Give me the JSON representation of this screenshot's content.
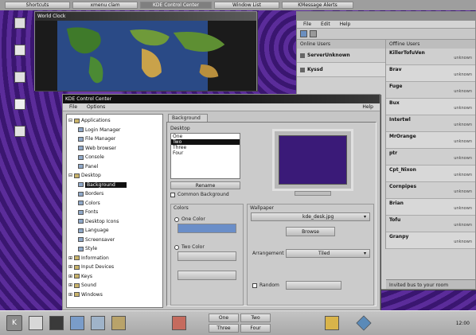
{
  "top_tabs": [
    "Shortcuts",
    "xmenu clam",
    "KDE Control Center",
    "Window List",
    "KMessage Alerts"
  ],
  "world_clock": {
    "title": "World Clock"
  },
  "users_window": {
    "menu": [
      "File",
      "Edit",
      "Help"
    ],
    "online_header": "Online Users",
    "offline_header": "Offline Users",
    "online_users": [
      "ServerUnknown",
      "Kyssd"
    ],
    "offline_users": [
      "KillerTofuVen",
      "Brav",
      "Fuge",
      "Bux",
      "Intertwl",
      "MrOrange",
      "ptr",
      "Cpt_Nixon",
      "Cornpipes",
      "Brian",
      "Tofu",
      "Granpy"
    ],
    "status_values": [
      "unknown",
      "unknown",
      "unknown",
      "unknown",
      "unknown",
      "unknown",
      "unknown",
      "unknown",
      "unknown",
      "unknown",
      "unknown",
      "unknown"
    ],
    "status_text": "Invited bus to your room"
  },
  "control_center": {
    "title": "KDE Control Center",
    "menu": [
      "File",
      "Options"
    ],
    "help_label": "Help",
    "tree": [
      {
        "label": "Applications",
        "level": 0,
        "expanded": true
      },
      {
        "label": "Login Manager",
        "level": 1
      },
      {
        "label": "File Manager",
        "level": 1
      },
      {
        "label": "Web browser",
        "level": 1
      },
      {
        "label": "Console",
        "level": 1
      },
      {
        "label": "Panel",
        "level": 1
      },
      {
        "label": "Desktop",
        "level": 0,
        "expanded": true
      },
      {
        "label": "Background",
        "level": 1,
        "selected": true
      },
      {
        "label": "Borders",
        "level": 1
      },
      {
        "label": "Colors",
        "level": 1
      },
      {
        "label": "Fonts",
        "level": 1
      },
      {
        "label": "Desktop Icons",
        "level": 1
      },
      {
        "label": "Language",
        "level": 1
      },
      {
        "label": "Screensaver",
        "level": 1
      },
      {
        "label": "Style",
        "level": 1
      },
      {
        "label": "Information",
        "level": 0
      },
      {
        "label": "Input Devices",
        "level": 0
      },
      {
        "label": "Keys",
        "level": 0
      },
      {
        "label": "Sound",
        "level": 0
      },
      {
        "label": "Windows",
        "level": 0
      }
    ],
    "tab_label": "Background",
    "desktop_group": "Desktop",
    "desktops": [
      "One",
      "Two",
      "Three",
      "Four"
    ],
    "rename_button": "Rename",
    "common_bg": "Common Background",
    "colors_group": "Colors",
    "one_color": "One Color",
    "two_color": "Two Color",
    "wallpaper_group": "Wallpaper",
    "wallpaper_file": "kde_desk.jpg",
    "browse_button": "Browse",
    "arrangement_label": "Arrangement",
    "arrangement_value": "Tiled",
    "random_label": "Random",
    "colors": {
      "preview": "#3a1a78",
      "one_color": "#6a8ec8"
    }
  },
  "taskbar": {
    "desk_buttons": [
      "One",
      "Two",
      "Three",
      "Four"
    ],
    "clock": "12:00"
  }
}
